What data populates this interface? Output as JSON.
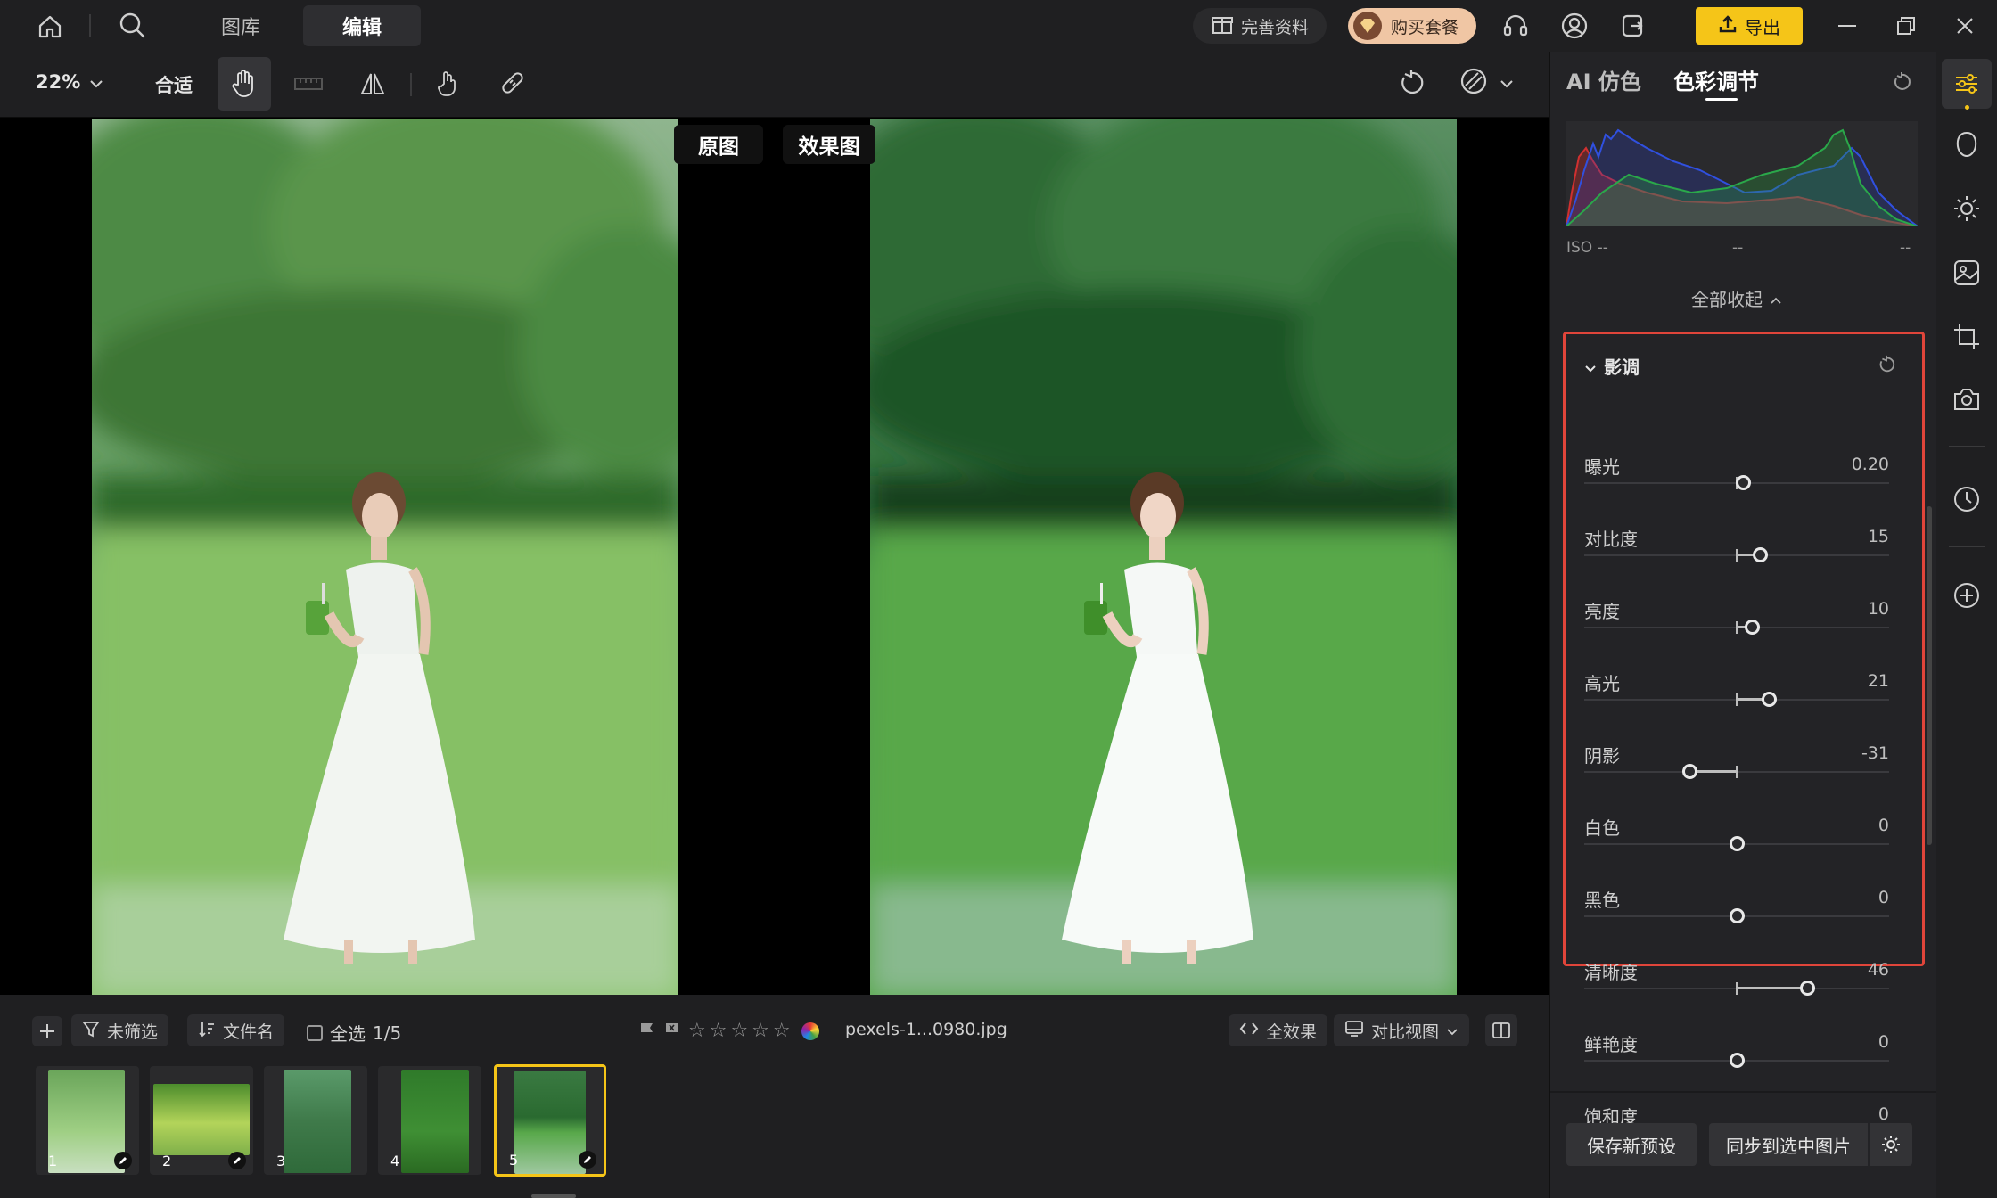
{
  "top": {
    "tabs": [
      {
        "label": "图库"
      },
      {
        "label": "编辑"
      }
    ],
    "complete_profile": "完善资料",
    "buy_package": "购买套餐",
    "export": "导出"
  },
  "toolbar": {
    "zoom": "22%",
    "fit": "合适"
  },
  "canvas": {
    "original_label": "原图",
    "result_label": "效果图"
  },
  "bottom": {
    "filter": "未筛选",
    "sort": "文件名",
    "select_all": "全选",
    "count": "1/5",
    "filename": "pexels-1...0980.jpg",
    "all_effects": "全效果",
    "compare_view": "对比视图",
    "thumbnails": [
      {
        "num": "1"
      },
      {
        "num": "2"
      },
      {
        "num": "3"
      },
      {
        "num": "4"
      },
      {
        "num": "5"
      }
    ],
    "selected_thumbnail": 5
  },
  "panel": {
    "tabs": [
      {
        "label": "AI 仿色"
      },
      {
        "label": "色彩调节"
      }
    ],
    "active_tab": 1,
    "histogram": {
      "iso": "ISO --",
      "mid": "--",
      "right": "--"
    },
    "collapse_all": "全部收起",
    "section_title": "影调",
    "sliders": [
      {
        "label": "曝光",
        "value": "0.20",
        "pos": 0.52
      },
      {
        "label": "对比度",
        "value": "15",
        "pos": 0.575
      },
      {
        "label": "亮度",
        "value": "10",
        "pos": 0.55
      },
      {
        "label": "高光",
        "value": "21",
        "pos": 0.605
      },
      {
        "label": "阴影",
        "value": "-31",
        "pos": 0.345
      },
      {
        "label": "白色",
        "value": "0",
        "pos": 0.5
      },
      {
        "label": "黑色",
        "value": "0",
        "pos": 0.5
      },
      {
        "label": "清晰度",
        "value": "46",
        "pos": 0.73
      },
      {
        "label": "鲜艳度",
        "value": "0",
        "pos": 0.5
      },
      {
        "label": "饱和度",
        "value": "0",
        "pos": 0.5
      }
    ],
    "save_preset": "保存新预设",
    "sync_selected": "同步到选中图片"
  },
  "colors": {
    "accent_yellow": "#f5c518",
    "highlight_red": "#e0453a",
    "buy_bg": "#f0c6a4"
  }
}
